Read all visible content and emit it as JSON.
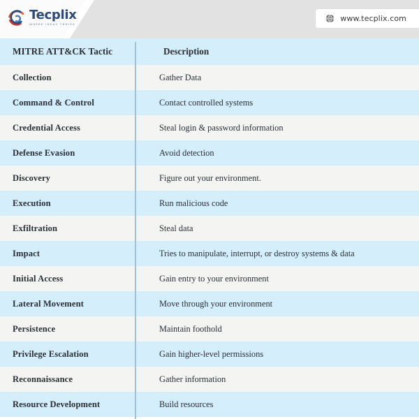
{
  "banner": {
    "logo": {
      "icon_name": "tecplix-swirl-logo-icon",
      "wordmark": "Tecplix",
      "tagline": "WHERE IDEAS THRIVE",
      "colors": {
        "orange": "#e8622a",
        "red": "#d6372b",
        "blue": "#2d4a7a",
        "light_blue": "#3f7fc4"
      }
    },
    "url_badge": {
      "icon_name": "globe-icon",
      "text": "www.tecplix.com"
    },
    "background_color": "#e2e2e2"
  },
  "table": {
    "headers": {
      "tactic": "MITRE ATT&CK Tactic",
      "description": "Description"
    },
    "header_background": "#d4eefb",
    "row_colors": {
      "odd": "#f4f4f2",
      "even": "#d4eefb"
    },
    "rows": [
      {
        "tactic": "Collection",
        "description": "Gather Data"
      },
      {
        "tactic": "Command & Control",
        "description": "Contact controlled systems"
      },
      {
        "tactic": "Credential Access",
        "description": "Steal login & password information"
      },
      {
        "tactic": "Defense Evasion",
        "description": "Avoid detection"
      },
      {
        "tactic": "Discovery",
        "description": "Figure out your environment."
      },
      {
        "tactic": "Execution",
        "description": "Run malicious code"
      },
      {
        "tactic": "Exfiltration",
        "description": "Steal data"
      },
      {
        "tactic": "Impact",
        "description": "Tries to manipulate, interrupt, or destroy systems & data"
      },
      {
        "tactic": "Initial Access",
        "description": "Gain entry to your environment"
      },
      {
        "tactic": "Lateral Movement",
        "description": "Move through your environment"
      },
      {
        "tactic": "Persistence",
        "description": "Maintain foothold"
      },
      {
        "tactic": "Privilege Escalation",
        "description": "Gain higher-level permissions"
      },
      {
        "tactic": "Reconnaissance",
        "description": "Gather information"
      },
      {
        "tactic": "Resource Development",
        "description": "Build resources"
      }
    ]
  }
}
